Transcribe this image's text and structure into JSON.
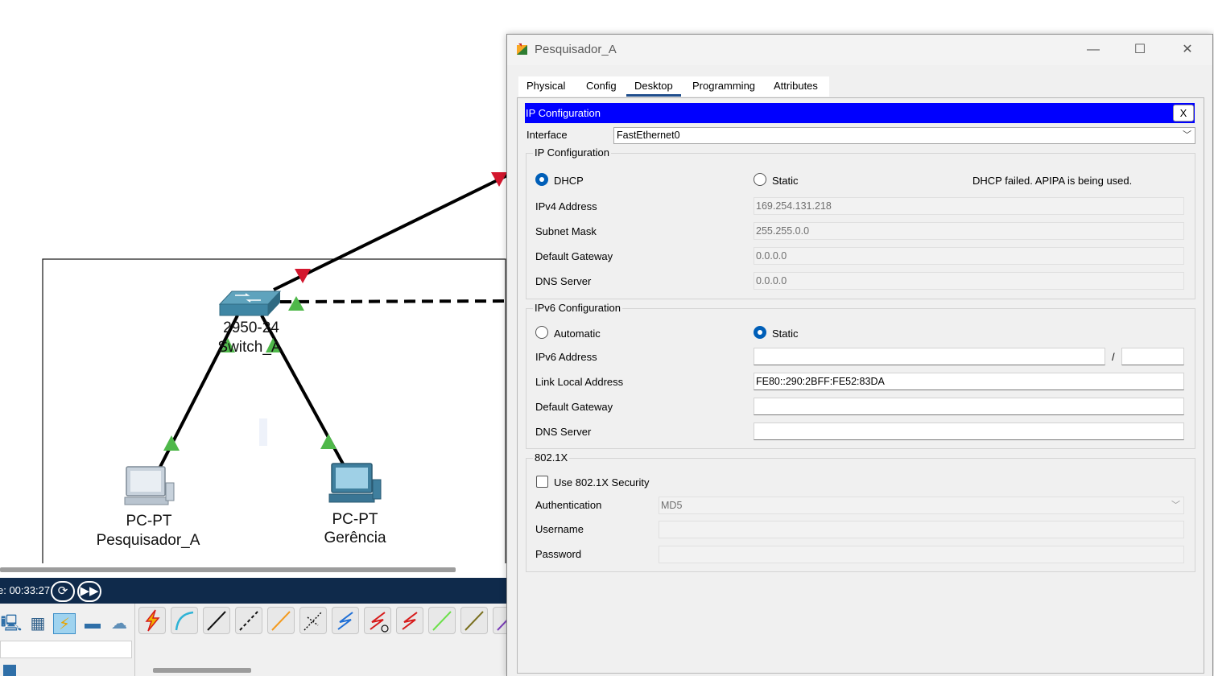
{
  "workspace": {
    "devices": [
      {
        "model": "2950-24",
        "name": "Switch_A"
      },
      {
        "model": "PC-PT",
        "name": "Pesquisador_A"
      },
      {
        "model": "PC-PT",
        "name": "Gerência"
      }
    ],
    "simulation": {
      "time_text": "e: 00:33:27",
      "reset_icon": "clock-reset-icon",
      "fast_forward_icon": "fast-forward-icon"
    },
    "device_categories": [
      "end-devices-icon",
      "network-devices-icon",
      "connections-icon",
      "components-folder-icon",
      "cloud-icon"
    ],
    "connection_types": [
      "automatic-icon",
      "console-icon",
      "copper-straight-icon",
      "copper-cross-icon",
      "fiber-icon",
      "phone-icon",
      "coaxial-icon",
      "serial-dce-icon",
      "serial-dte-icon",
      "octal-icon",
      "iot-icon",
      "usb-icon"
    ]
  },
  "dialog": {
    "title": "Pesquisador_A",
    "controls": {
      "minimize": "—",
      "maximize": "☐",
      "close": "✕"
    },
    "tabs": [
      "Physical",
      "Config",
      "Desktop",
      "Programming",
      "Attributes"
    ],
    "active_tab": "Desktop",
    "ip_config": {
      "header": "IP Configuration",
      "close": "X",
      "interface_label": "Interface",
      "interface_value": "FastEthernet0",
      "ipv4": {
        "title": "IP Configuration",
        "dhcp_label": "DHCP",
        "static_label": "Static",
        "selected": "DHCP",
        "status": "DHCP failed. APIPA is being used.",
        "ipv4_address_label": "IPv4 Address",
        "ipv4_address": "169.254.131.218",
        "subnet_mask_label": "Subnet Mask",
        "subnet_mask": "255.255.0.0",
        "default_gateway_label": "Default Gateway",
        "default_gateway": "0.0.0.0",
        "dns_server_label": "DNS Server",
        "dns_server": "0.0.0.0"
      },
      "ipv6": {
        "title": "IPv6 Configuration",
        "automatic_label": "Automatic",
        "static_label": "Static",
        "selected": "Static",
        "ipv6_address_label": "IPv6 Address",
        "ipv6_address": "",
        "prefix_separator": "/",
        "prefix": "",
        "link_local_label": "Link Local Address",
        "link_local": "FE80::290:2BFF:FE52:83DA",
        "default_gateway_label": "Default Gateway",
        "default_gateway": "",
        "dns_server_label": "DNS Server",
        "dns_server": ""
      },
      "dot1x": {
        "title": "802.1X",
        "use_label": "Use 802.1X Security",
        "use_checked": false,
        "authentication_label": "Authentication",
        "authentication": "MD5",
        "username_label": "Username",
        "username": "",
        "password_label": "Password",
        "password": ""
      }
    }
  }
}
